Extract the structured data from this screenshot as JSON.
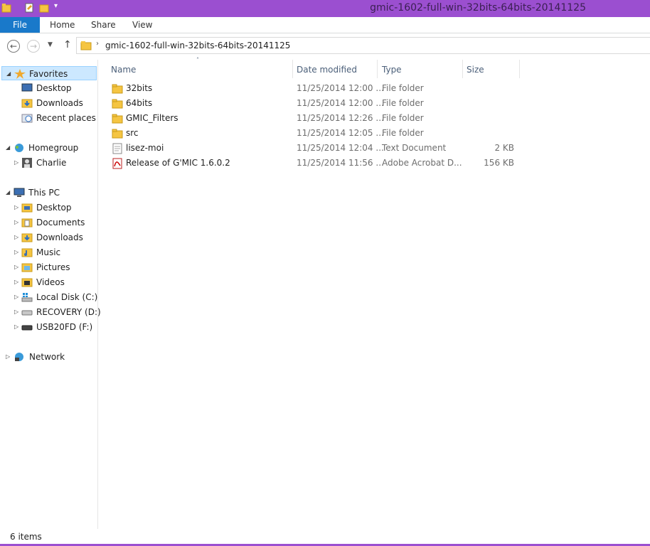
{
  "title_bar": {
    "title": "gmic-1602-full-win-32bits-64bits-20141125",
    "accent": "#9b4fd0"
  },
  "ribbon": {
    "file": "File",
    "tabs": [
      "Home",
      "Share",
      "View"
    ]
  },
  "address": {
    "path": "gmic-1602-full-win-32bits-64bits-20141125"
  },
  "nav": {
    "favorites": {
      "label": "Favorites",
      "items": [
        "Desktop",
        "Downloads",
        "Recent places"
      ]
    },
    "homegroup": {
      "label": "Homegroup",
      "items": [
        "Charlie"
      ]
    },
    "this_pc": {
      "label": "This PC",
      "items": [
        "Desktop",
        "Documents",
        "Downloads",
        "Music",
        "Pictures",
        "Videos",
        "Local Disk (C:)",
        "RECOVERY (D:)",
        "USB20FD (F:)"
      ]
    },
    "network": {
      "label": "Network"
    }
  },
  "columns": {
    "name": "Name",
    "date": "Date modified",
    "type": "Type",
    "size": "Size"
  },
  "files": [
    {
      "name": "32bits",
      "date": "11/25/2014 12:00 ...",
      "type": "File folder",
      "size": "",
      "icon": "folder-icon"
    },
    {
      "name": "64bits",
      "date": "11/25/2014 12:00 ...",
      "type": "File folder",
      "size": "",
      "icon": "folder-icon"
    },
    {
      "name": "GMIC_Filters",
      "date": "11/25/2014 12:26 ...",
      "type": "File folder",
      "size": "",
      "icon": "folder-icon"
    },
    {
      "name": "src",
      "date": "11/25/2014 12:05 ...",
      "type": "File folder",
      "size": "",
      "icon": "folder-icon"
    },
    {
      "name": "lisez-moi",
      "date": "11/25/2014 12:04 ...",
      "type": "Text Document",
      "size": "2 KB",
      "icon": "text-file-icon"
    },
    {
      "name": "Release of G'MIC 1.6.0.2",
      "date": "11/25/2014 11:56 ...",
      "type": "Adobe Acrobat D...",
      "size": "156 KB",
      "icon": "pdf-icon"
    }
  ],
  "status": {
    "count": "6 items"
  }
}
